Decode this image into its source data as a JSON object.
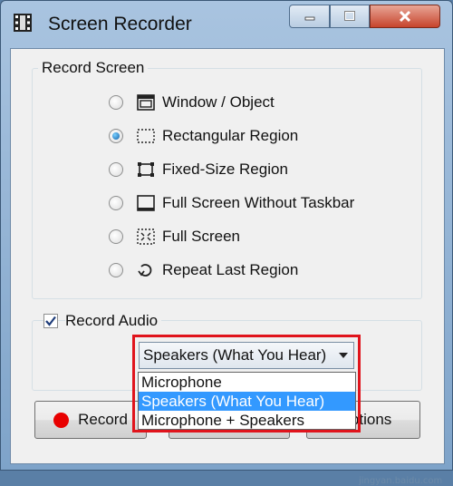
{
  "window": {
    "title": "Screen Recorder",
    "icon": "film-icon"
  },
  "titlebar_buttons": [
    "minimize",
    "maximize",
    "close"
  ],
  "record_screen": {
    "label": "Record Screen",
    "options": [
      {
        "label": "Window / Object",
        "icon": "window-object-icon",
        "checked": false
      },
      {
        "label": "Rectangular Region",
        "icon": "rectangular-region-icon",
        "checked": true
      },
      {
        "label": "Fixed-Size Region",
        "icon": "fixed-size-region-icon",
        "checked": false
      },
      {
        "label": "Full Screen Without Taskbar",
        "icon": "full-screen-without-taskbar-icon",
        "checked": false
      },
      {
        "label": "Full Screen",
        "icon": "full-screen-icon",
        "checked": false
      },
      {
        "label": "Repeat Last Region",
        "icon": "repeat-last-region-icon",
        "checked": false
      }
    ]
  },
  "record_audio": {
    "label": "Record Audio",
    "checked": true,
    "selected": "Speakers (What You Hear)",
    "options": [
      "Microphone",
      "Speakers (What You Hear)",
      "Microphone + Speakers"
    ]
  },
  "buttons": {
    "record": "Record",
    "options": "Options"
  },
  "watermark": "jingyan.baidu.com",
  "colors": {
    "accent": "#3399ff",
    "highlight_border": "#e0141c",
    "record_dot": "#e80000"
  }
}
